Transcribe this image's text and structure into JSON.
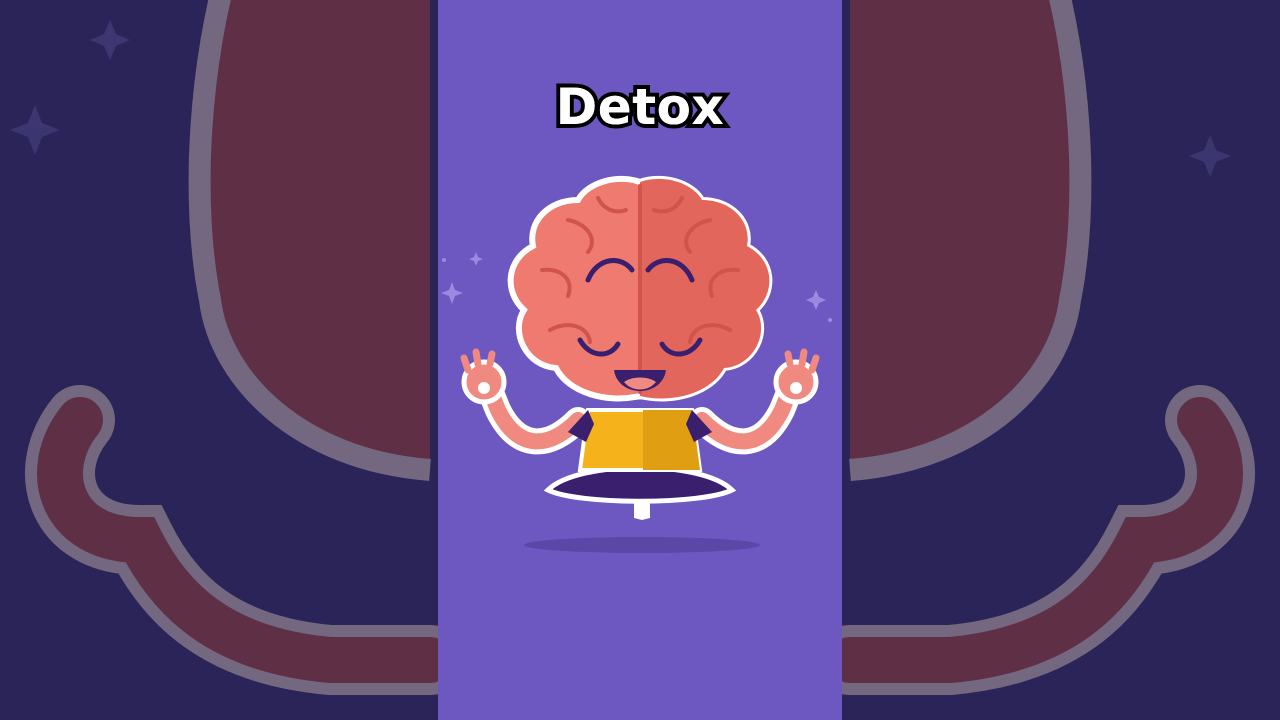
{
  "caption": {
    "text": "Detox"
  },
  "illustration": {
    "subject": "meditating-brain-mascot-icon",
    "colors": {
      "panel_background": "#6c58c0",
      "backdrop": "#2a2458",
      "brain": "#ee7a70",
      "brain_shade": "#e3665d",
      "outline": "#ffffff",
      "shirt": "#f5b21b",
      "pants": "#3a1f6e",
      "skin": "#f08a80",
      "shadow": "#5a47a8"
    }
  }
}
